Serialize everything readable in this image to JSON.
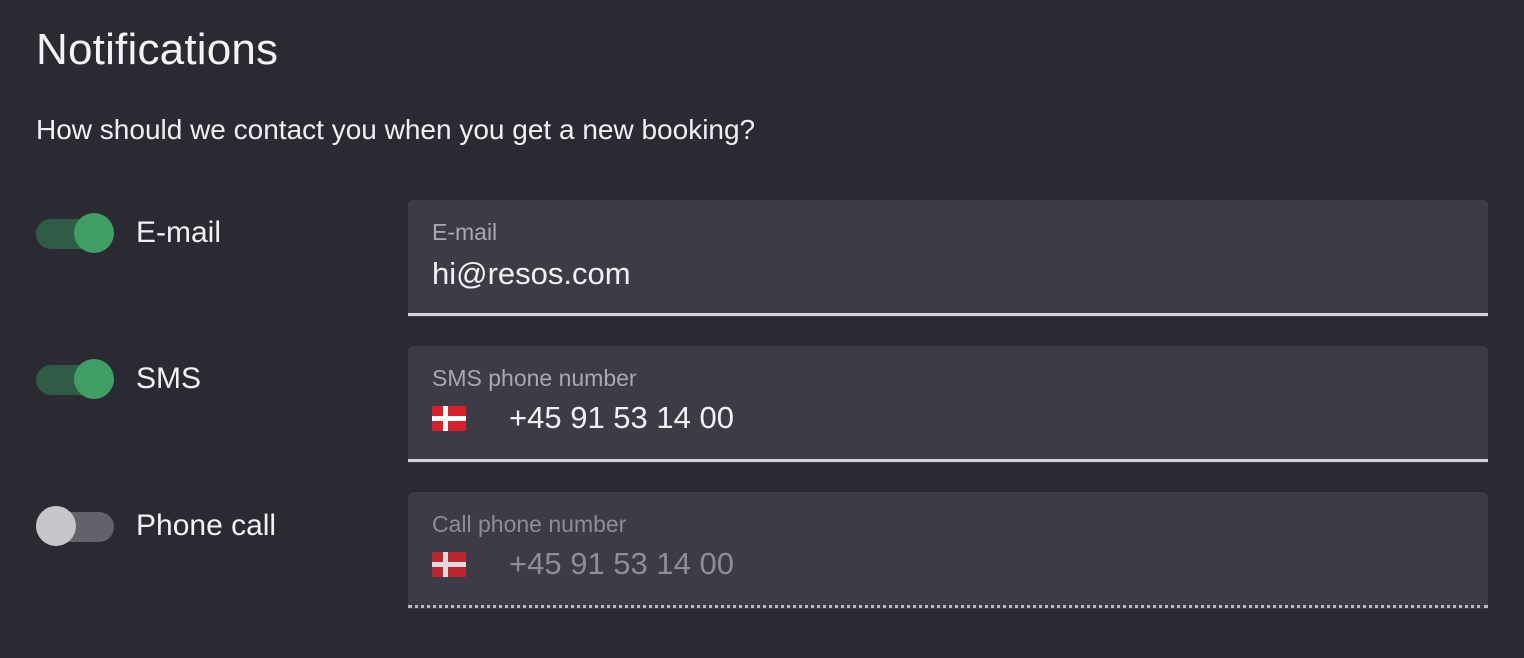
{
  "header": {
    "title": "Notifications",
    "subtitle": "How should we contact you when you get a new booking?"
  },
  "channels": [
    {
      "key": "email",
      "toggle_label": "E-mail",
      "toggle_state": "on",
      "field_label": "E-mail",
      "field_value": "hi@resos.com",
      "has_flag": false,
      "disabled": false
    },
    {
      "key": "sms",
      "toggle_label": "SMS",
      "toggle_state": "on",
      "field_label": "SMS phone number",
      "field_value": "+45 91 53 14 00",
      "has_flag": true,
      "flag": "denmark-flag-icon",
      "disabled": false
    },
    {
      "key": "phone_call",
      "toggle_label": "Phone call",
      "toggle_state": "off",
      "field_label": "Call phone number",
      "field_value": "+45 91 53 14 00",
      "has_flag": true,
      "flag": "denmark-flag-icon",
      "disabled": true
    }
  ],
  "colors": {
    "background": "#2b2a33",
    "field_background": "#3d3b45",
    "toggle_on_track": "#2f5c46",
    "toggle_on_knob": "#3f9e63",
    "toggle_off_knob": "#c6c6cb",
    "text_primary": "#f2f2f5",
    "text_muted": "#a9a8b0",
    "text_disabled": "#8e8d96",
    "underline": "#d4d4d8",
    "flag_red": "#d81f2a",
    "flag_white": "#ffffff"
  }
}
